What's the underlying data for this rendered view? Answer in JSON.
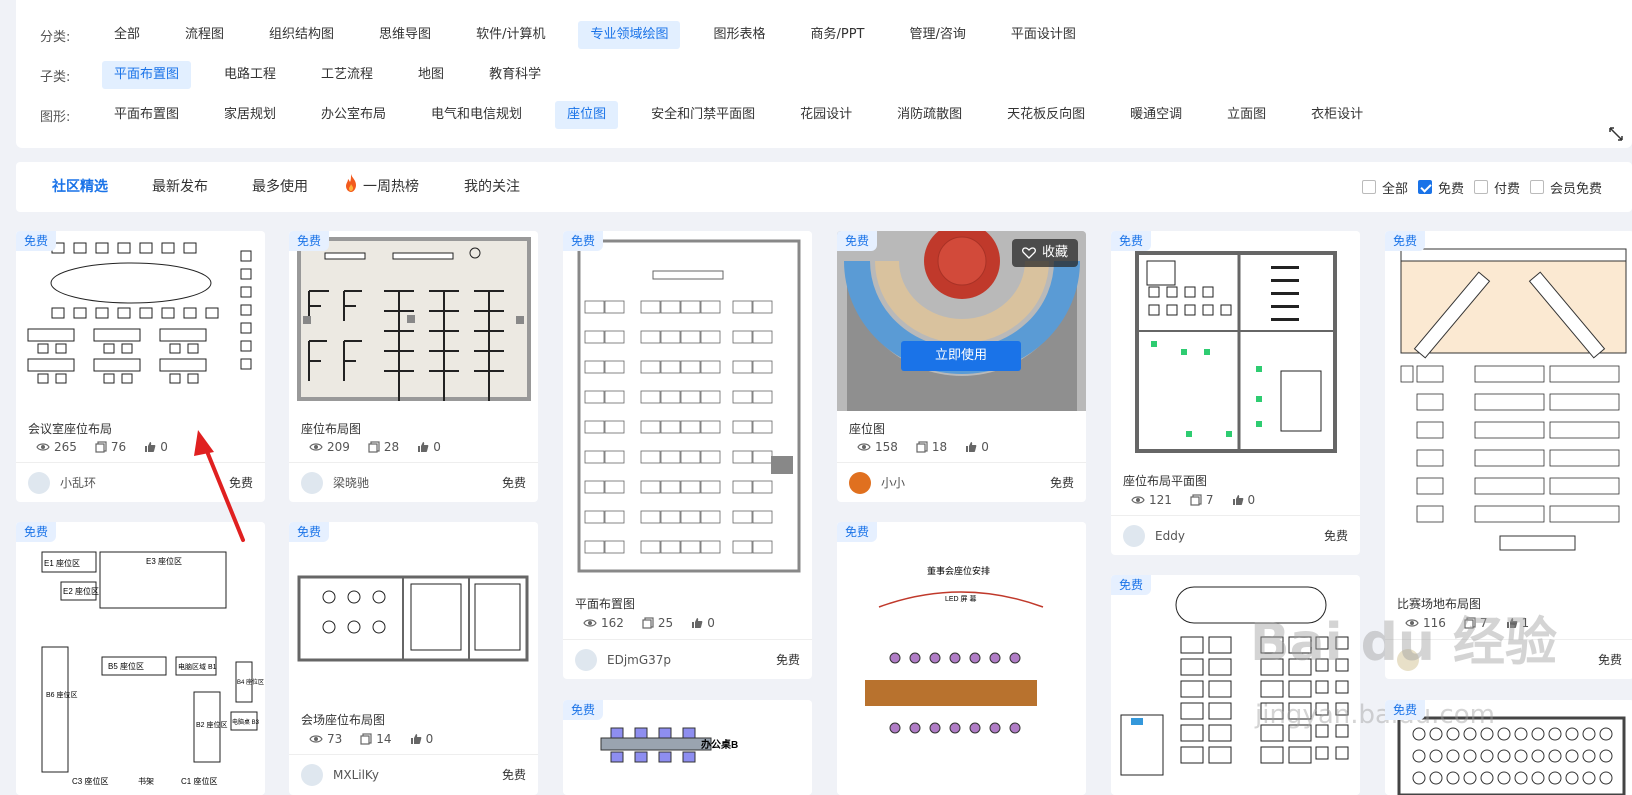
{
  "filters": {
    "category": {
      "label": "分类:",
      "options": [
        "全部",
        "流程图",
        "组织结构图",
        "思维导图",
        "软件/计算机",
        "专业领域绘图",
        "图形表格",
        "商务/PPT",
        "管理/咨询",
        "平面设计图"
      ],
      "active": 5
    },
    "subcategory": {
      "label": "子类:",
      "options": [
        "平面布置图",
        "电路工程",
        "工艺流程",
        "地图",
        "教育科学"
      ],
      "active": 0
    },
    "shape": {
      "label": "图形:",
      "options": [
        "平面布置图",
        "家居规划",
        "办公室布局",
        "电气和电信规划",
        "座位图",
        "安全和门禁平面图",
        "花园设计",
        "消防疏散图",
        "天花板反向图",
        "暖通空调",
        "立面图",
        "衣柜设计"
      ],
      "active": 4
    }
  },
  "tabs": [
    "社区精选",
    "最新发布",
    "最多使用",
    "一周热榜",
    "我的关注"
  ],
  "price_filters": [
    {
      "label": "全部",
      "checked": false
    },
    {
      "label": "免费",
      "checked": true
    },
    {
      "label": "付费",
      "checked": false
    },
    {
      "label": "会员免费",
      "checked": false
    }
  ],
  "badge_free": "免费",
  "cards": [
    {
      "title": "会议室座位布局",
      "views": "265",
      "copies": "76",
      "likes": "0",
      "author": "小乱环",
      "fee": "免费"
    },
    {
      "title": "座位布局图",
      "views": "209",
      "copies": "28",
      "likes": "0",
      "author": "梁晓驰",
      "fee": "免费"
    },
    {
      "title": "平面布置图",
      "views": "162",
      "copies": "25",
      "likes": "0",
      "author": "EDjmG37p",
      "fee": "免费"
    },
    {
      "title": "座位图",
      "views": "158",
      "copies": "18",
      "likes": "0",
      "author": "小小",
      "fee": "免费",
      "fav_label": "收藏",
      "use_label": "立即使用"
    },
    {
      "title": "座位布局平面图",
      "views": "121",
      "copies": "7",
      "likes": "0",
      "author": "Eddy",
      "fee": "免费"
    },
    {
      "title": "比赛场地布局图",
      "views": "116",
      "copies": "7",
      "likes": "1",
      "author": "",
      "fee": "免费"
    },
    {
      "title": "会场座位布局图",
      "views": "73",
      "copies": "14",
      "likes": "0",
      "author": "MXLilKy",
      "fee": "免费"
    }
  ],
  "thumb_text": {
    "c2_zones": [
      "E1 座位区",
      "E3 座位区",
      "E2 座位区",
      "B6 座位区",
      "B5 座位区",
      "电脑区域 B1",
      "B2 座位区",
      "B4 座位区",
      "电脑桌 B3",
      "C3 座位区",
      "书架",
      "C1 座位区"
    ],
    "c4_title": "董事会座位安排",
    "c4_screen": "LED 屏 幕",
    "c3_desk": "办公桌B"
  },
  "watermark": {
    "main": "Bai du 经验",
    "sub": "jingyan.baidu.com"
  },
  "colors": {
    "accent": "#1a73e8",
    "active_bg": "#e2efff",
    "page_bg": "#f0f2f7"
  }
}
